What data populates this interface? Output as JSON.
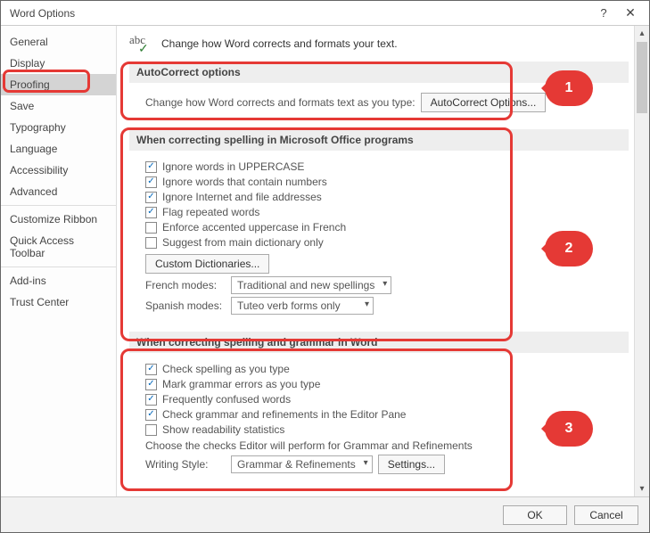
{
  "window": {
    "title": "Word Options"
  },
  "sidebar": {
    "items": [
      {
        "label": "General"
      },
      {
        "label": "Display"
      },
      {
        "label": "Proofing",
        "selected": true
      },
      {
        "label": "Save"
      },
      {
        "label": "Typography"
      },
      {
        "label": "Language"
      },
      {
        "label": "Accessibility"
      },
      {
        "label": "Advanced"
      }
    ],
    "items2": [
      {
        "label": "Customize Ribbon"
      },
      {
        "label": "Quick Access Toolbar"
      }
    ],
    "items3": [
      {
        "label": "Add-ins"
      },
      {
        "label": "Trust Center"
      }
    ]
  },
  "intro": {
    "icon_text": "abc",
    "text": "Change how Word corrects and formats your text."
  },
  "section_autocorrect": {
    "title": "AutoCorrect options",
    "desc": "Change how Word corrects and formats text as you type:",
    "button": "AutoCorrect Options..."
  },
  "section_spelling_office": {
    "title": "When correcting spelling in Microsoft Office programs",
    "opts": [
      {
        "label": "Ignore words in UPPERCASE",
        "checked": true
      },
      {
        "label": "Ignore words that contain numbers",
        "checked": true
      },
      {
        "label": "Ignore Internet and file addresses",
        "checked": true
      },
      {
        "label": "Flag repeated words",
        "checked": true
      },
      {
        "label": "Enforce accented uppercase in French",
        "checked": false
      },
      {
        "label": "Suggest from main dictionary only",
        "checked": false
      }
    ],
    "custom_dict_btn": "Custom Dictionaries...",
    "french_label": "French modes:",
    "french_value": "Traditional and new spellings",
    "spanish_label": "Spanish modes:",
    "spanish_value": "Tuteo verb forms only"
  },
  "section_spelling_word": {
    "title": "When correcting spelling and grammar in Word",
    "opts": [
      {
        "label": "Check spelling as you type",
        "checked": true
      },
      {
        "label": "Mark grammar errors as you type",
        "checked": true
      },
      {
        "label": "Frequently confused words",
        "checked": true
      },
      {
        "label": "Check grammar and refinements in the Editor Pane",
        "checked": true
      },
      {
        "label": "Show readability statistics",
        "checked": false
      }
    ],
    "choose_text": "Choose the checks Editor will perform for Grammar and Refinements",
    "style_label": "Writing Style:",
    "style_value": "Grammar & Refinements",
    "settings_btn": "Settings..."
  },
  "footer": {
    "ok": "OK",
    "cancel": "Cancel"
  },
  "annotations": {
    "b1": "1",
    "b2": "2",
    "b3": "3"
  }
}
